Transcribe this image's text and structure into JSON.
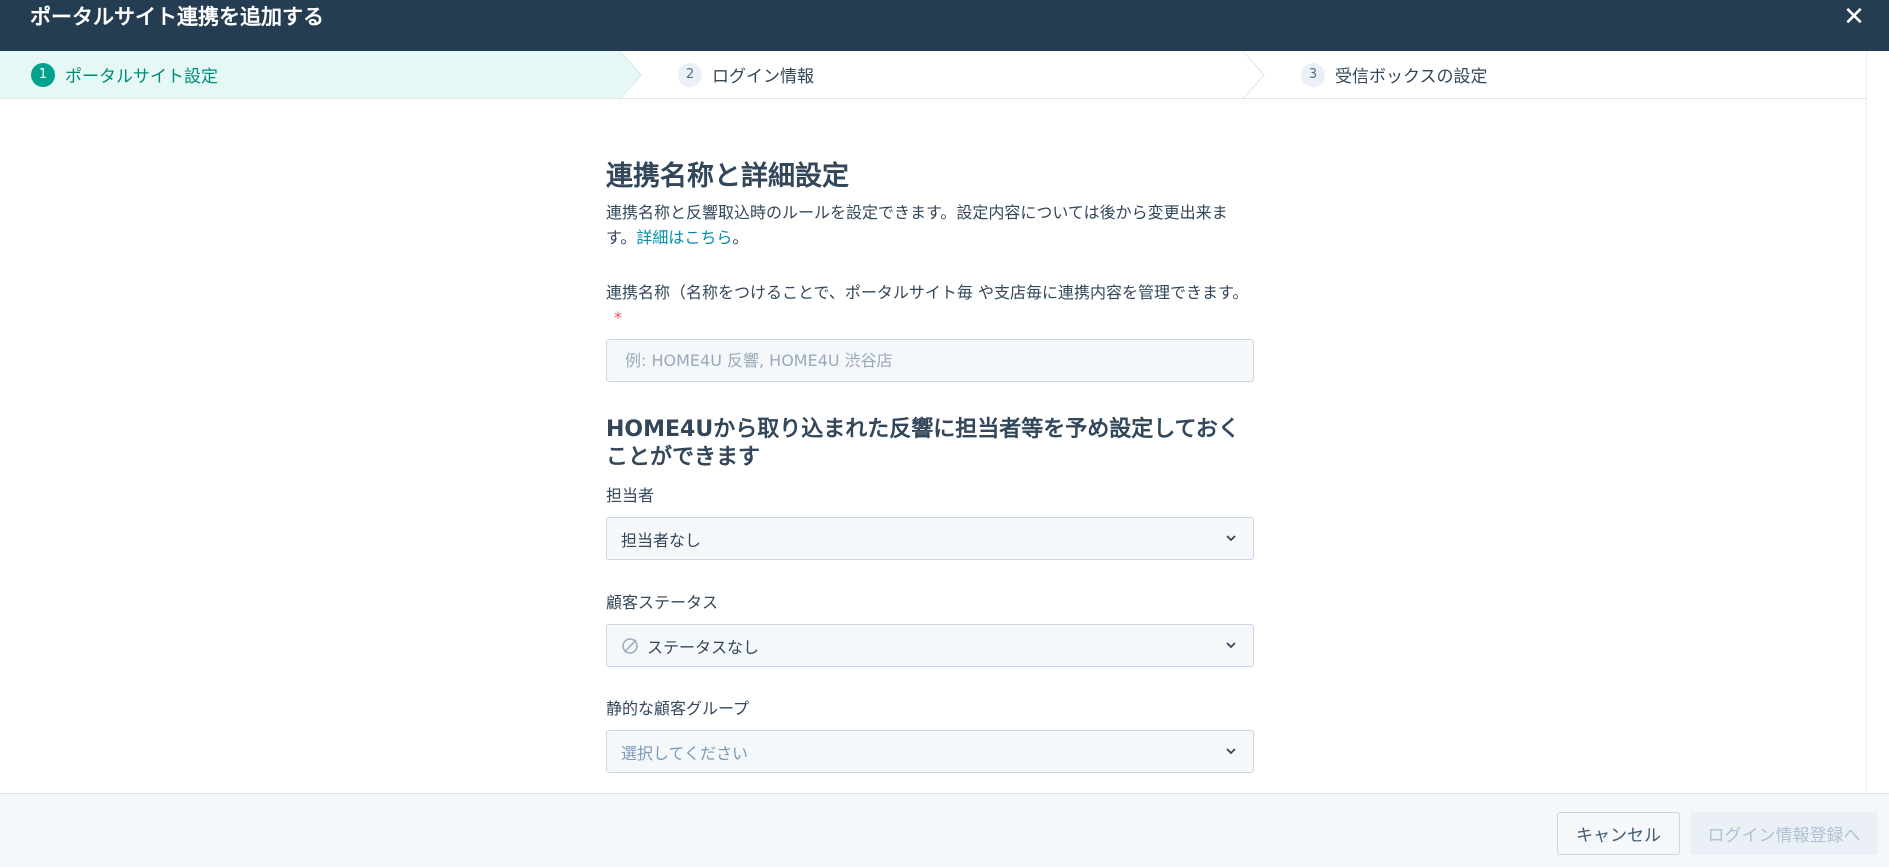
{
  "header": {
    "title": "ポータルサイト連携を追加する",
    "close_symbol": "✕"
  },
  "steps": [
    {
      "num": "1",
      "label": "ポータルサイト設定",
      "active": true
    },
    {
      "num": "2",
      "label": "ログイン情報",
      "active": false
    },
    {
      "num": "3",
      "label": "受信ボックスの設定",
      "active": false
    }
  ],
  "main": {
    "title": "連携名称と詳細設定",
    "description": "連携名称と反響取込時のルールを設定できます。設定内容については後から変更出来ます。",
    "details_link": "詳細はこちら",
    "details_suffix": "。",
    "name_field": {
      "label": "連携名称（名称をつけることで、ポータルサイト毎 や支店毎に連携内容を管理できます。",
      "required_mark": "*",
      "placeholder": "例: HOME4U 反響, HOME4U 渋谷店",
      "value": ""
    },
    "preset_title": "HOME4Uから取り込まれた反響に担当者等を予め設定しておくことができます",
    "owner": {
      "label": "担当者",
      "value": "担当者なし"
    },
    "status": {
      "label": "顧客ステータス",
      "value": "ステータスなし"
    },
    "group": {
      "label": "静的な顧客グループ",
      "placeholder": "選択してください"
    }
  },
  "footer": {
    "cancel_label": "キャンセル",
    "next_label": "ログイン情報登録へ"
  },
  "colors": {
    "header_bg": "#253d52",
    "active_step_bg": "#e5f8f6",
    "active_step_accent": "#00a38d",
    "link": "#0091ae",
    "required": "#f2545b"
  }
}
